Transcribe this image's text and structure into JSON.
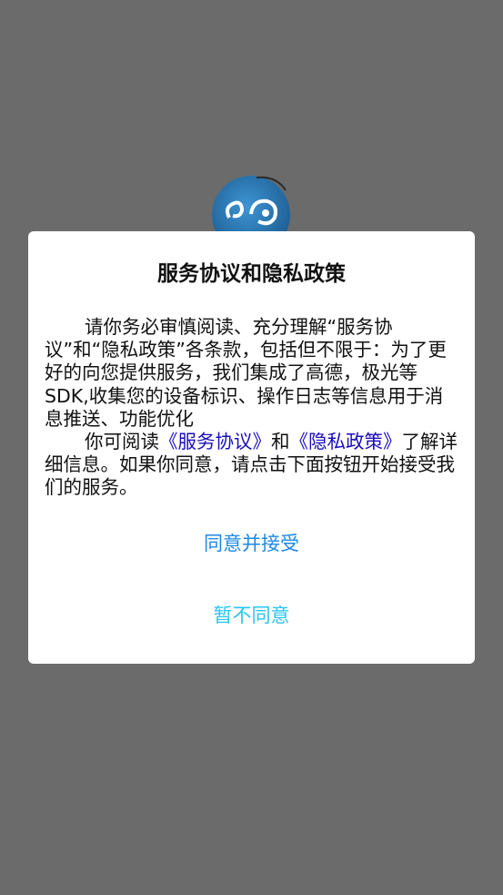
{
  "background_color": "#6b6b6b",
  "logo": {
    "icon": "app-logo-icon",
    "color": "#2a7fc0"
  },
  "dialog": {
    "title": "服务协议和隐私政策",
    "paragraph1": "请你务必审慎阅读、充分理解“服务协议”和“隐私政策”各条款，包括但不限于：为了更好的向您提供服务，我们集成了高德，极光等SDK,收集您的设备标识、操作日志等信息用于消息推送、功能优化",
    "paragraph2_prefix": "你可阅读",
    "service_link": "《服务协议》",
    "paragraph2_and": "和",
    "privacy_link": "《隐私政策》",
    "paragraph2_suffix": "了解详细信息。如果你同意，请点击下面按钮开始接受我们的服务。",
    "agree_button": "同意并接受",
    "decline_button": "暂不同意",
    "link_color": "#1a0dbf",
    "agree_color": "#1e88e5",
    "decline_color": "#29c6f0"
  }
}
